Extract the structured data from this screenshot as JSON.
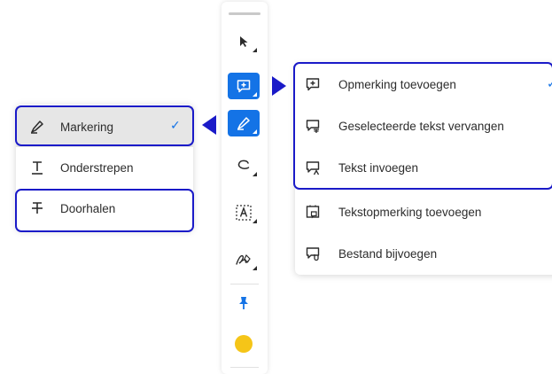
{
  "left_menu": {
    "items": [
      {
        "label": "Markering",
        "icon": "highlighter-icon",
        "selected": true
      },
      {
        "label": "Onderstrepen",
        "icon": "underline-icon",
        "selected": false
      },
      {
        "label": "Doorhalen",
        "icon": "strikethrough-icon",
        "selected": false
      }
    ],
    "check": "✓"
  },
  "right_menu": {
    "items": [
      {
        "label": "Opmerking toevoegen",
        "icon": "comment-add-icon"
      },
      {
        "label": "Geselecteerde tekst vervangen",
        "icon": "replace-text-icon"
      },
      {
        "label": "Tekst invoegen",
        "icon": "insert-text-icon"
      },
      {
        "label": "Tekstopmerking toevoegen",
        "icon": "text-comment-icon"
      },
      {
        "label": "Bestand bijvoegen",
        "icon": "attach-file-icon"
      }
    ],
    "check": "✓"
  },
  "toolbar": {
    "tools": [
      {
        "name": "select-tool",
        "icon": "cursor-arrow-icon"
      },
      {
        "name": "comment-tool",
        "icon": "comment-add-icon",
        "active": true
      },
      {
        "name": "highlight-tool",
        "icon": "highlighter-icon",
        "active": true
      },
      {
        "name": "draw-tool",
        "icon": "freehand-draw-icon"
      },
      {
        "name": "text-box-tool",
        "icon": "text-box-icon"
      },
      {
        "name": "sign-tool",
        "icon": "signature-icon"
      },
      {
        "name": "pin-tool",
        "icon": "pin-icon"
      }
    ],
    "current_color": "#f5c518"
  },
  "colors": {
    "accent": "#1473e6",
    "highlight_frame": "#1a1ac8",
    "selected_row": "#e6e6e6"
  }
}
